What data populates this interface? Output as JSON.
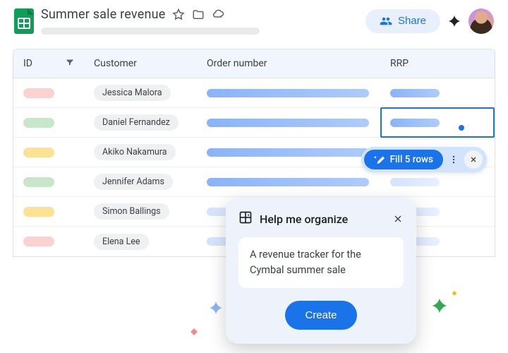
{
  "header": {
    "doc_title": "Summer sale revenue",
    "share_label": "Share"
  },
  "table": {
    "columns": {
      "id": "ID",
      "customer": "Customer",
      "order": "Order number",
      "rrp": "RRP"
    },
    "rows": [
      {
        "id_color": "red",
        "customer": "Jessica Malora",
        "order_faded": false,
        "rrp_faded": false,
        "rrp_selected": false
      },
      {
        "id_color": "green",
        "customer": "Daniel Fernandez",
        "order_faded": false,
        "rrp_faded": false,
        "rrp_selected": true
      },
      {
        "id_color": "yellow",
        "customer": "Akiko Nakamura",
        "order_faded": false,
        "rrp_faded": true,
        "rrp_selected": false
      },
      {
        "id_color": "green",
        "customer": "Jennifer Adams",
        "order_faded": false,
        "rrp_faded": true,
        "rrp_selected": false
      },
      {
        "id_color": "yellow",
        "customer": "Simon Ballings",
        "order_faded": true,
        "rrp_faded": true,
        "rrp_selected": false
      },
      {
        "id_color": "red",
        "customer": "Elena Lee",
        "order_faded": true,
        "rrp_faded": true,
        "rrp_selected": false
      }
    ]
  },
  "fill_chip": {
    "label": "Fill 5 rows"
  },
  "hmo": {
    "title": "Help me organize",
    "prompt": "A revenue tracker for the Cymbal summer sale",
    "create_label": "Create"
  }
}
